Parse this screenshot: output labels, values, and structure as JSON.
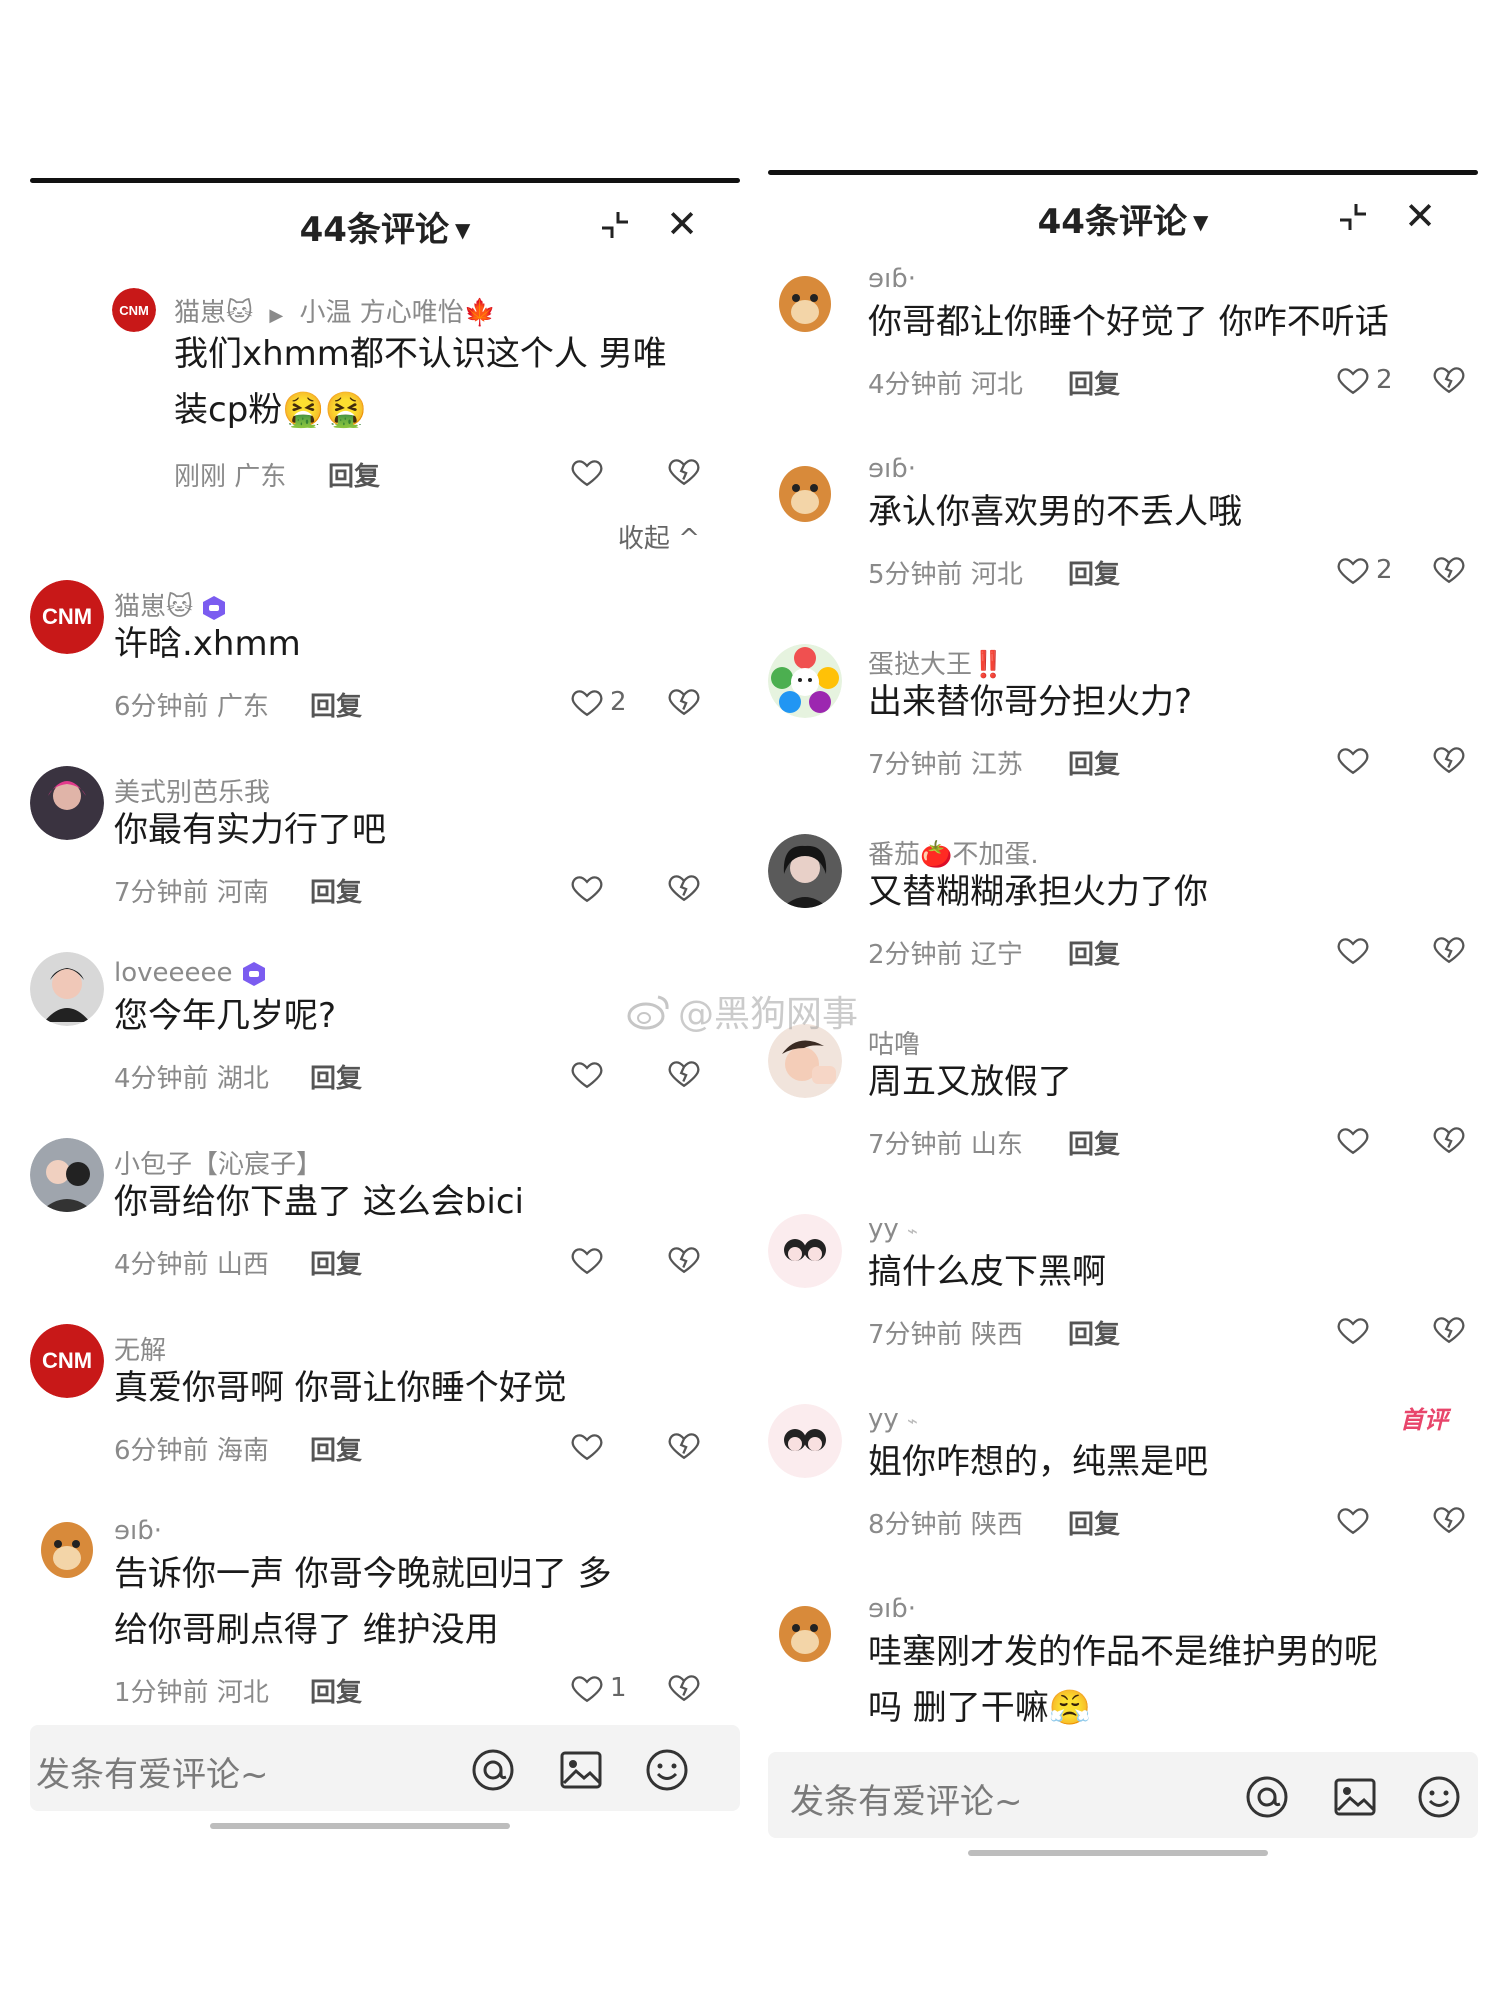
{
  "left": {
    "header": {
      "title": "44条评论"
    },
    "input": {
      "placeholder": "发条有爱评论~"
    },
    "collapse_label": "收起",
    "reply_comment": {
      "user": "猫崽🐱",
      "reply_to": "小温 方心唯怡🍁",
      "text_line1": "我们xhmm都不认识这个人 男唯",
      "text_line2": "装cp粉🤮🤮",
      "time": "刚刚",
      "location": "广东",
      "reply_label": "回复"
    },
    "comments": [
      {
        "user": "猫崽🐱",
        "text": "许晗.xhmm",
        "time": "6分钟前",
        "location": "广东",
        "reply_label": "回复",
        "likes": "2"
      },
      {
        "user": "美式别芭乐我",
        "text": "你最有实力行了吧",
        "time": "7分钟前",
        "location": "河南",
        "reply_label": "回复",
        "likes": ""
      },
      {
        "user": "loveeeee",
        "text": "您今年几岁呢?",
        "time": "4分钟前",
        "location": "湖北",
        "reply_label": "回复",
        "likes": ""
      },
      {
        "user": "小包子【沁宸子】",
        "text": "你哥给你下蛊了 这么会bici",
        "time": "4分钟前",
        "location": "山西",
        "reply_label": "回复",
        "likes": ""
      },
      {
        "user": "无解",
        "text": "真爱你哥啊 你哥让你睡个好觉",
        "time": "6分钟前",
        "location": "海南",
        "reply_label": "回复",
        "likes": ""
      },
      {
        "user": "ɘıɓ·",
        "text_line1": "告诉你一声  你哥今晚就回归了  多",
        "text_line2": "给你哥刷点得了  维护没用",
        "time": "1分钟前",
        "location": "河北",
        "reply_label": "回复",
        "likes": "1"
      }
    ]
  },
  "right": {
    "header": {
      "title": "44条评论"
    },
    "input": {
      "placeholder": "发条有爱评论~"
    },
    "first_review_label": "首评",
    "comments": [
      {
        "user": "ɘıɓ·",
        "text": "你哥都让你睡个好觉了  你咋不听话",
        "time": "4分钟前",
        "location": "河北",
        "reply_label": "回复",
        "likes": "2"
      },
      {
        "user": "ɘıɓ·",
        "text": "承认你喜欢男的不丢人哦",
        "time": "5分钟前",
        "location": "河北",
        "reply_label": "回复",
        "likes": "2"
      },
      {
        "user": "蛋挞大王‼️",
        "text": "出来替你哥分担火力?",
        "time": "7分钟前",
        "location": "江苏",
        "reply_label": "回复",
        "likes": ""
      },
      {
        "user": "番茄🍅不加蛋.",
        "text": "又替糊糊承担火力了你",
        "time": "2分钟前",
        "location": "辽宁",
        "reply_label": "回复",
        "likes": ""
      },
      {
        "user": "咕噜",
        "text": "周五又放假了",
        "time": "7分钟前",
        "location": "山东",
        "reply_label": "回复",
        "likes": ""
      },
      {
        "user": "yy",
        "text": "搞什么皮下黑啊",
        "time": "7分钟前",
        "location": "陕西",
        "reply_label": "回复",
        "likes": ""
      },
      {
        "user": "yy",
        "text": "姐你咋想的，纯黑是吧",
        "time": "8分钟前",
        "location": "陕西",
        "reply_label": "回复",
        "likes": ""
      },
      {
        "user": "ɘıɓ·",
        "text_line1": "哇塞刚才发的作品不是维护男的呢",
        "text_line2": "吗  删了干嘛😤",
        "time": "",
        "location": "",
        "reply_label": "",
        "likes": ""
      }
    ]
  },
  "watermark": {
    "text": "@黑狗网事"
  },
  "colors": {
    "text": "#1a1a1a",
    "secondary": "#8a8a8a",
    "first_review": "#e8456b",
    "badge": "#7b5cf0"
  }
}
